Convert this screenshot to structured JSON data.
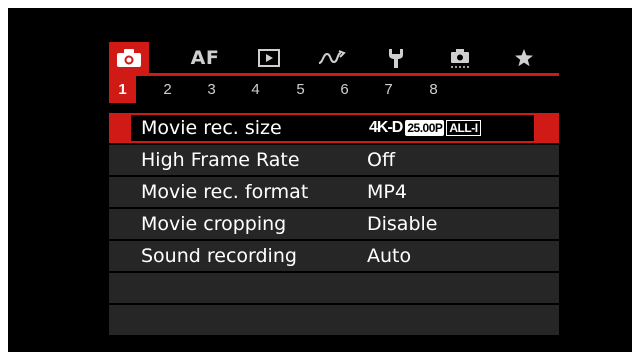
{
  "tabs": [
    {
      "icon": "camera-icon",
      "active": true
    },
    {
      "label": "AF",
      "active": false
    },
    {
      "icon": "playback-icon",
      "active": false
    },
    {
      "icon": "wireless-icon",
      "active": false
    },
    {
      "icon": "wrench-icon",
      "active": false
    },
    {
      "icon": "custom-functions-icon",
      "active": false
    },
    {
      "icon": "star-icon",
      "active": false
    }
  ],
  "pages": [
    "1",
    "2",
    "3",
    "4",
    "5",
    "6",
    "7",
    "8"
  ],
  "active_page": "1",
  "menu": {
    "items": [
      {
        "label": "Movie rec. size",
        "value_parts": [
          "4K-D",
          "25.00P",
          "ALL-I"
        ]
      },
      {
        "label": "High Frame Rate",
        "value": "Off"
      },
      {
        "label": "Movie rec. format",
        "value": "MP4"
      },
      {
        "label": "Movie cropping",
        "value": "Disable"
      },
      {
        "label": "Sound recording",
        "value": "Auto"
      }
    ]
  },
  "colors": {
    "accent": "#d01a16",
    "row_bg": "#262626",
    "background": "#000000"
  }
}
